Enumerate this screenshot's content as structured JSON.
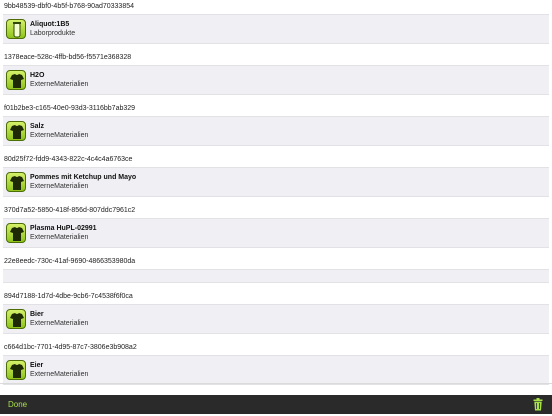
{
  "items": [
    {
      "uuid": "9bb48539-dbf0-4b5f-b768-90ad70333854",
      "title": "Aliquot:1B5",
      "subtitle": "Laborprodukte",
      "icon": "test-tube-icon"
    },
    {
      "uuid": "1378eace-528c-4ffb-bd56-f5571e368328",
      "title": "H2O",
      "subtitle": "ExterneMaterialien",
      "icon": "shirt-icon"
    },
    {
      "uuid": "f01b2be3-c165-40e0-93d3-3116bb7ab329",
      "title": "Salz",
      "subtitle": "ExterneMaterialien",
      "icon": "shirt-icon"
    },
    {
      "uuid": "80d25f72-fdd9-4343-822c-4c4c4a6763ce",
      "title": "Pommes mit Ketchup und Mayo",
      "subtitle": "ExterneMaterialien",
      "icon": "shirt-icon"
    },
    {
      "uuid": "370d7a52-5850-418f-856d-807ddc7961c2",
      "title": "Plasma HuPL-02991",
      "subtitle": "ExterneMaterialien",
      "icon": "shirt-icon"
    },
    {
      "uuid": "22e8eedc-730c-41af-9690-4866353980da",
      "title": "",
      "subtitle": "",
      "icon": ""
    },
    {
      "uuid": "894d7188-1d7d-4dbe-9cb6-7c4538f6f0ca",
      "title": "Bier",
      "subtitle": "ExterneMaterialien",
      "icon": "shirt-icon"
    },
    {
      "uuid": "c664d1bc-7701-4d95-87c7-3806e3b908a2",
      "title": "Eier",
      "subtitle": "ExterneMaterialien",
      "icon": "shirt-icon"
    }
  ],
  "toolbar": {
    "done_label": "Done",
    "trash_icon": "trash-icon"
  },
  "colors": {
    "accent": "#a8e04a",
    "toolbar_bg": "#2a2a2a",
    "row_bg": "#efeff4"
  }
}
